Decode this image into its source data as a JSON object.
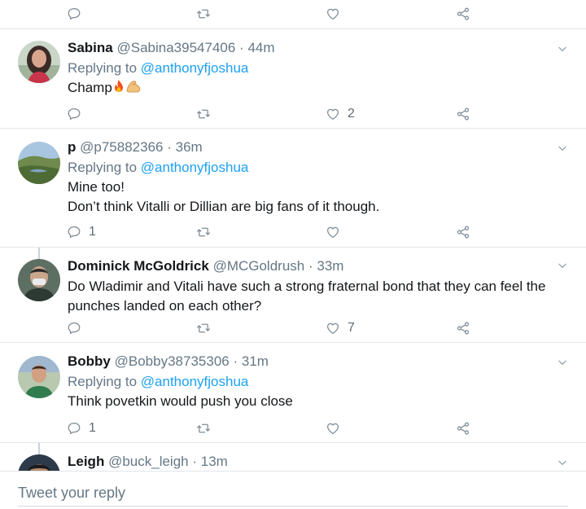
{
  "top_actions": {
    "reply_count": "",
    "retweet_count": "",
    "like_count": ""
  },
  "tweets": [
    {
      "name": "Sabina",
      "handle": "@Sabina39547406",
      "sep": "·",
      "time": "44m",
      "replying_prefix": "Replying to ",
      "replying_to": "@anthonyfjoshua",
      "text_lines": [
        "Champ"
      ],
      "emojis": [
        "fire",
        "flexed-biceps"
      ],
      "reply_count": "",
      "retweet_count": "",
      "like_count": "2"
    },
    {
      "name": "p",
      "handle": "@p75882366",
      "sep": "·",
      "time": "36m",
      "replying_prefix": "Replying to ",
      "replying_to": "@anthonyfjoshua",
      "text_lines": [
        "Mine too!",
        "Don’t think Vitalli or Dillian are big fans of it though."
      ],
      "reply_count": "1",
      "retweet_count": "",
      "like_count": ""
    },
    {
      "name": "Dominick McGoldrick",
      "handle": "@MCGoldrush",
      "sep": "·",
      "time": "33m",
      "text_lines": [
        "Do Wladimir and Vitali have such a strong fraternal bond that they can feel the",
        "punches landed on each other?"
      ],
      "reply_count": "",
      "retweet_count": "",
      "like_count": "7"
    },
    {
      "name": "Bobby",
      "handle": "@Bobby38735306",
      "sep": "·",
      "time": "31m",
      "replying_prefix": "Replying to ",
      "replying_to": "@anthonyfjoshua",
      "text_lines": [
        "Think povetkin would push you close"
      ],
      "reply_count": "1",
      "retweet_count": "",
      "like_count": ""
    },
    {
      "name": "Leigh",
      "handle": "@buck_leigh",
      "sep": "·",
      "time": "13m"
    }
  ],
  "composer": {
    "placeholder": "Tweet your reply"
  },
  "icons": {
    "reply": "reply-icon",
    "retweet": "retweet-icon",
    "like": "heart-icon",
    "share": "share-icon",
    "menu": "chevron-down-icon"
  },
  "colors": {
    "link": "#1da1f2",
    "secondary_text": "#657786",
    "divider": "#e1e6ea"
  }
}
